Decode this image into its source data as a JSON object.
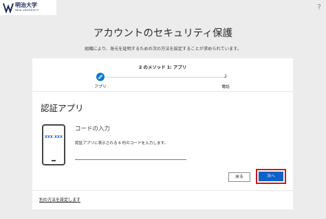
{
  "brand": {
    "title": "明治大学",
    "subtitle": "MEIJI UNIVERSITY",
    "color": "#1f2a5a"
  },
  "header": {
    "help_icon": "question-mark-icon",
    "help_glyph": "?"
  },
  "page": {
    "title": "アカウントのセキュリティ保護",
    "subtitle": "組織により、身元を証明するための次の方法を設定することが求められています。"
  },
  "progress": {
    "heading": "2 のメソッド 1: アプリ",
    "steps": [
      {
        "number": "1",
        "label": "アプリ",
        "state": "active",
        "icon": "pencil-icon"
      },
      {
        "number": "2",
        "label": "電話",
        "state": "pending"
      }
    ],
    "accent": "#0078d4"
  },
  "method": {
    "title": "認証アプリ",
    "phone_code": "XXX XXX",
    "code_title": "コードの入力",
    "instruction": "認証アプリに表示される 6 桁のコードを入力します。",
    "input_value": ""
  },
  "actions": {
    "back_label": "戻る",
    "next_label": "次へ",
    "next_color": "#0f63c8",
    "highlight_color": "#d0141e"
  },
  "footer": {
    "other_method_link": "別の方法を設定します"
  }
}
